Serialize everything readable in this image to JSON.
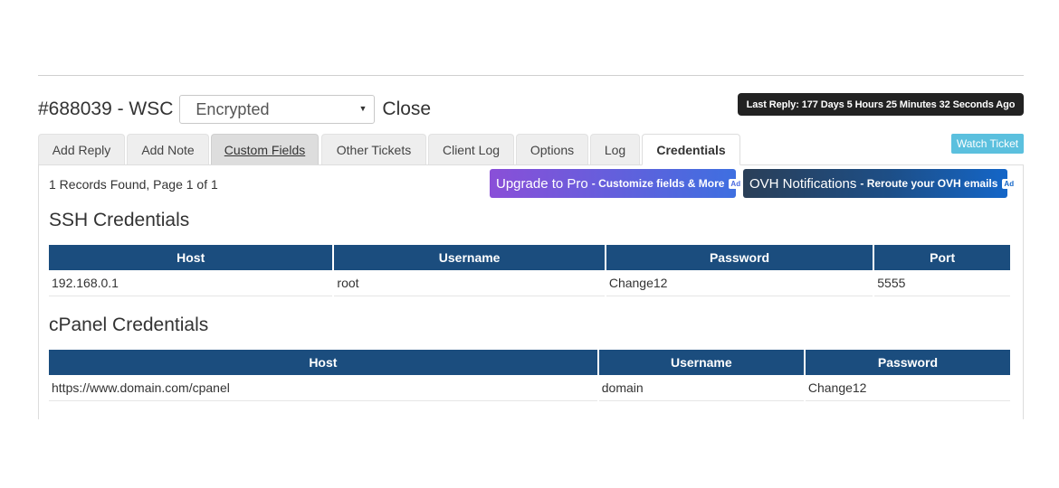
{
  "ticket": {
    "id_title": "#688039 - WSC",
    "status_value": "Encrypted",
    "close_label": "Close",
    "last_reply": "Last Reply: 177 Days 5 Hours 25 Minutes 32 Seconds Ago",
    "watch_label": "Watch Ticket"
  },
  "tabs": [
    {
      "label": "Add Reply"
    },
    {
      "label": "Add Note"
    },
    {
      "label": "Custom Fields"
    },
    {
      "label": "Other Tickets"
    },
    {
      "label": "Client Log"
    },
    {
      "label": "Options"
    },
    {
      "label": "Log"
    },
    {
      "label": "Credentials"
    }
  ],
  "panel": {
    "records_text": "1 Records Found, Page 1 of 1",
    "promo_pro": {
      "main": "Upgrade to Pro",
      "sub": "- Customize fields & More",
      "badge": "Ad"
    },
    "promo_ovh": {
      "main": "OVH Notifications",
      "sub": "- Reroute your OVH emails",
      "badge": "Ad"
    }
  },
  "ssh": {
    "title": "SSH Credentials",
    "headers": [
      "Host",
      "Username",
      "Password",
      "Port"
    ],
    "row": [
      "192.168.0.1",
      "root",
      "Change12",
      "5555"
    ]
  },
  "cpanel": {
    "title": "cPanel Credentials",
    "headers": [
      "Host",
      "Username",
      "Password"
    ],
    "row": [
      "https://www.domain.com/cpanel",
      "domain",
      "Change12"
    ]
  },
  "colors": {
    "table_header": "#1b4d7e",
    "watch_button": "#5bc0de",
    "last_reply_bg": "#222222"
  }
}
